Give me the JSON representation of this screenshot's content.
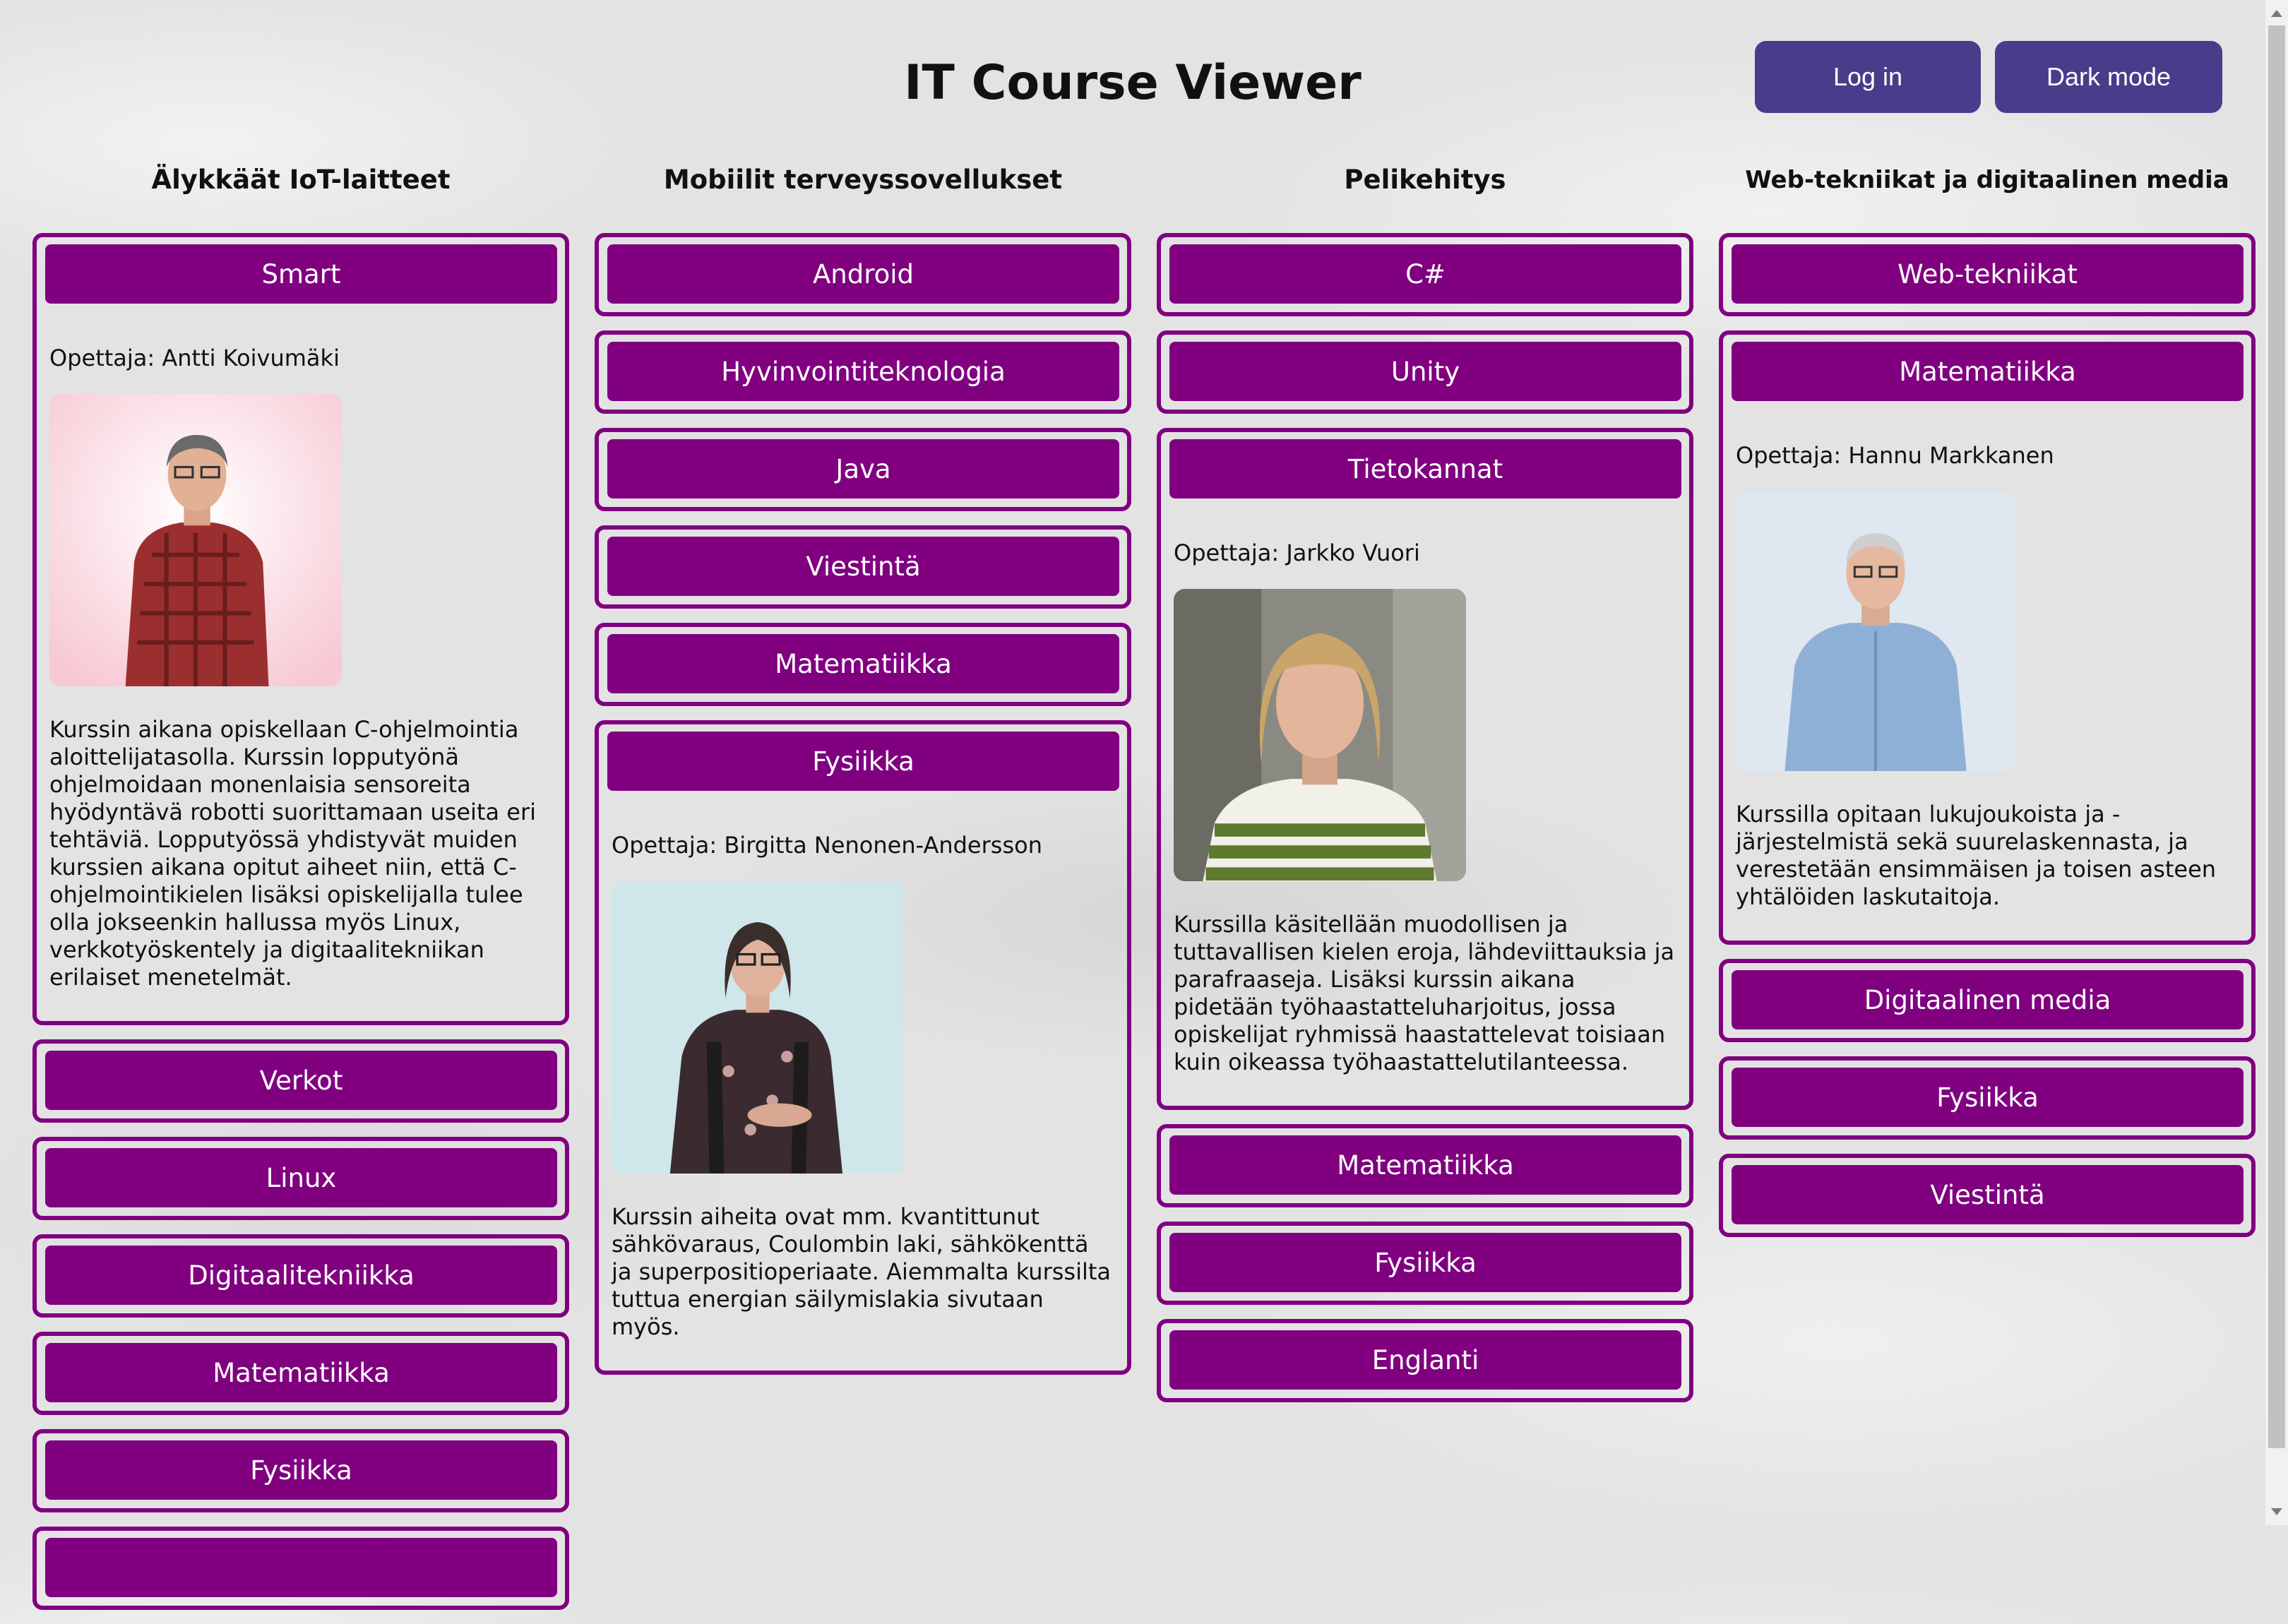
{
  "header": {
    "title": "IT Course Viewer",
    "login_label": "Log in",
    "dark_mode_label": "Dark mode"
  },
  "colors": {
    "course_purple": "#800080",
    "header_button": "#483d8b",
    "background": "#e3e3e3"
  },
  "columns": [
    {
      "heading": "Älykkäät IoT-laitteet",
      "courses": [
        {
          "name": "Smart",
          "expanded": true,
          "teacher": "Opettaja: Antti Koivumäki",
          "photo": "teacher-photo-red-shirt",
          "description": "Kurssin aikana opiskellaan C-ohjelmointia aloittelijatasolla. Kurssin lopputyönä ohjelmoidaan monenlaisia sensoreita hyödyntävä robotti suorittamaan useita eri tehtäviä. Lopputyössä yhdistyvät muiden kurssien aikana opitut aiheet niin, että C-ohjelmointikielen lisäksi opiskelijalla tulee olla jokseenkin hallussa myös Linux, verkkotyöskentely ja digitaalitekniikan erilaiset menetelmät."
        },
        {
          "name": "Verkot"
        },
        {
          "name": "Linux"
        },
        {
          "name": "Digitaalitekniikka"
        },
        {
          "name": "Matematiikka"
        },
        {
          "name": "Fysiikka"
        },
        {
          "name": ""
        }
      ]
    },
    {
      "heading": "Mobiilit terveyssovellukset",
      "courses": [
        {
          "name": "Android"
        },
        {
          "name": "Hyvinvointiteknologia"
        },
        {
          "name": "Java"
        },
        {
          "name": "Viestintä"
        },
        {
          "name": "Matematiikka"
        },
        {
          "name": "Fysiikka",
          "expanded": true,
          "teacher": "Opettaja: Birgitta Nenonen-Andersson",
          "photo": "teacher-photo-woman",
          "description": "Kurssin aiheita ovat mm. kvantittunut sähkövaraus, Coulombin laki, sähkökenttä ja superpositioperiaate. Aiemmalta kurssilta tuttua energian säilymislakia sivutaan myös."
        }
      ]
    },
    {
      "heading": "Pelikehitys",
      "courses": [
        {
          "name": "C#"
        },
        {
          "name": "Unity"
        },
        {
          "name": "Tietokannat",
          "expanded": true,
          "teacher": "Opettaja: Jarkko Vuori",
          "photo": "teacher-photo-long-hair",
          "description": "Kurssilla käsitellään muodollisen ja tuttavallisen kielen eroja, lähdeviittauksia ja parafraaseja. Lisäksi kurssin aikana pidetään työhaastatteluharjoitus, jossa opiskelijat ryhmissä haastattelevat toisiaan kuin oikeassa työhaastattelutilanteessa."
        },
        {
          "name": "Matematiikka"
        },
        {
          "name": "Fysiikka"
        },
        {
          "name": "Englanti"
        }
      ]
    },
    {
      "heading": "Web-tekniikat ja digitaalinen media",
      "courses": [
        {
          "name": "Web-tekniikat"
        },
        {
          "name": "Matematiikka",
          "expanded": true,
          "teacher": "Opettaja: Hannu Markkanen",
          "photo": "teacher-photo-blue-shirt",
          "description": "Kurssilla opitaan lukujoukoista ja -järjestelmistä sekä suurelaskennasta, ja verestetään ensimmäisen ja toisen asteen yhtälöiden laskutaitoja."
        },
        {
          "name": "Digitaalinen media"
        },
        {
          "name": "Fysiikka"
        },
        {
          "name": "Viestintä"
        }
      ]
    }
  ]
}
